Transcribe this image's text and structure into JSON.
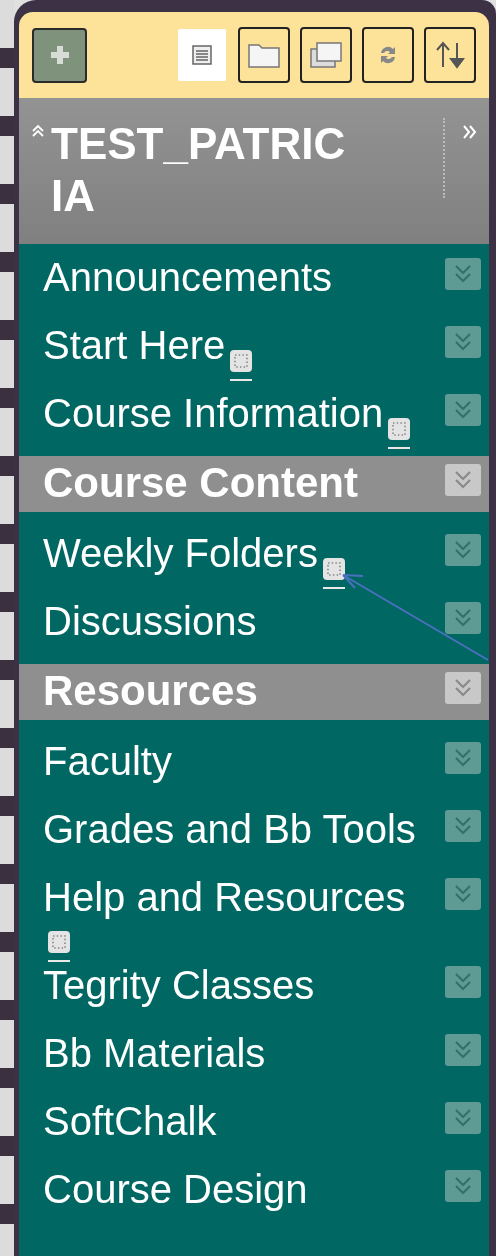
{
  "toolbar": {
    "add_button": {
      "kind": "add"
    },
    "view_buttons": [
      {
        "kind": "list",
        "selected": true
      },
      {
        "kind": "folder",
        "selected": false
      },
      {
        "kind": "windows",
        "selected": false
      },
      {
        "kind": "refresh",
        "selected": false
      },
      {
        "kind": "sort",
        "selected": false
      }
    ]
  },
  "course": {
    "title": "TEST_PATRICIA"
  },
  "menu_items": [
    {
      "kind": "link",
      "label": "Announcements",
      "page_icon": false
    },
    {
      "kind": "link",
      "label": "Start Here",
      "page_icon": true
    },
    {
      "kind": "link",
      "label": "Course Information",
      "page_icon": true
    },
    {
      "kind": "header",
      "label": "Course Content",
      "page_icon": false
    },
    {
      "kind": "link",
      "label": "Weekly Folders",
      "page_icon": true
    },
    {
      "kind": "link",
      "label": "Discussions",
      "page_icon": false
    },
    {
      "kind": "header",
      "label": "Resources",
      "page_icon": false
    },
    {
      "kind": "link",
      "label": "Faculty",
      "page_icon": false
    },
    {
      "kind": "link",
      "label": "Grades and Bb Tools",
      "page_icon": false
    },
    {
      "kind": "link",
      "label": "Help and Resources",
      "page_icon": true
    },
    {
      "kind": "link",
      "label": "Tegrity Classes",
      "page_icon": false
    },
    {
      "kind": "link",
      "label": "Bb Materials",
      "page_icon": false
    },
    {
      "kind": "link",
      "label": "SoftChalk",
      "page_icon": false
    },
    {
      "kind": "link",
      "label": "Course Design",
      "page_icon": false
    }
  ]
}
